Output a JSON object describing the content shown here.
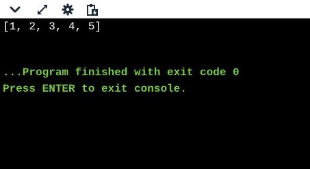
{
  "toolbar": {
    "buttons": [
      {
        "name": "collapse",
        "icon": "chevron-down-icon"
      },
      {
        "name": "expand",
        "icon": "expand-arrows-icon"
      },
      {
        "name": "settings",
        "icon": "gear-icon"
      },
      {
        "name": "copy",
        "icon": "clipboard-copy-icon"
      }
    ]
  },
  "console": {
    "output_line": "[1, 2, 3, 4, 5]",
    "finished_line": "...Program finished with exit code 0",
    "exit_prompt_line": "Press ENTER to exit console."
  },
  "colors": {
    "background": "#000000",
    "output_text": "#ffffff",
    "status_text": "#79c84a",
    "toolbar_bg": "#ffffff",
    "icon": "#1e2a3a"
  }
}
